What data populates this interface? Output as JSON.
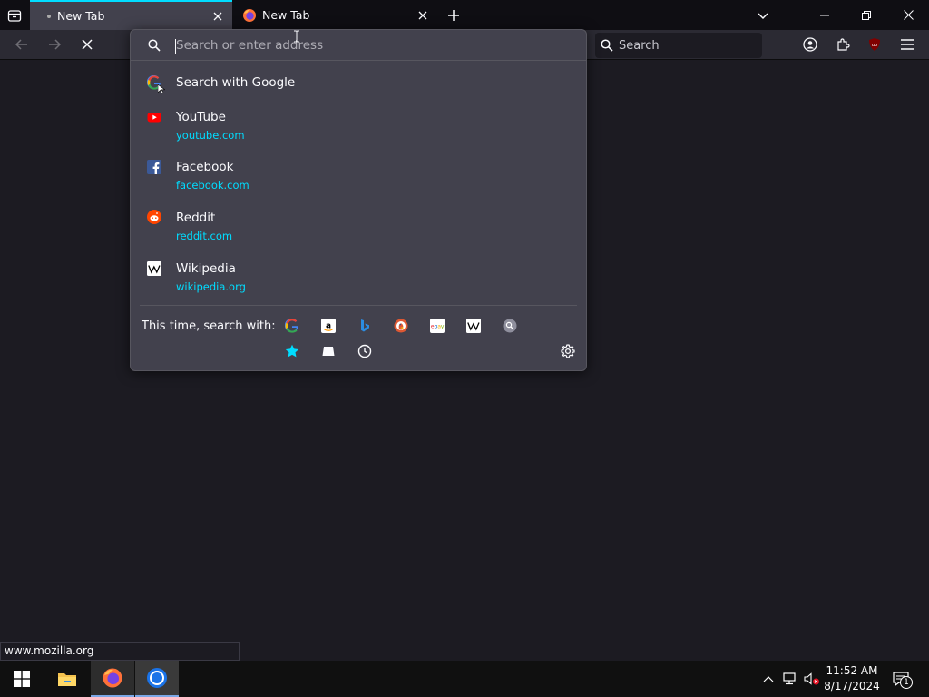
{
  "tabs": [
    {
      "title": "New Tab",
      "active": true
    },
    {
      "title": "New Tab",
      "active": false
    }
  ],
  "urlbar": {
    "placeholder": "Search or enter address"
  },
  "search_field": {
    "placeholder": "Search"
  },
  "suggestions": [
    {
      "name": "Search with Google",
      "url": "",
      "icon": "google-icon"
    },
    {
      "name": "YouTube",
      "url": "youtube.com",
      "icon": "youtube-icon"
    },
    {
      "name": "Facebook",
      "url": "facebook.com",
      "icon": "facebook-icon"
    },
    {
      "name": "Reddit",
      "url": "reddit.com",
      "icon": "reddit-icon"
    },
    {
      "name": "Wikipedia",
      "url": "wikipedia.org",
      "icon": "wikipedia-icon"
    }
  ],
  "search_with_label": "This time, search with:",
  "engines": [
    "google-icon",
    "amazon-icon",
    "bing-icon",
    "duckduckgo-icon",
    "ebay-icon",
    "wikipedia-icon",
    "search-engine-icon",
    "bookmarks-star-icon",
    "tabs-icon",
    "history-clock-icon"
  ],
  "status": {
    "text": "www.mozilla.org"
  },
  "taskbar": {
    "time": "11:52 AM",
    "date": "8/17/2024",
    "notification_count": "1"
  },
  "colors": {
    "accent": "#00ddff",
    "panel": "#42414d",
    "toolbar": "#2b2a33",
    "tabbar": "#0f0e13"
  }
}
